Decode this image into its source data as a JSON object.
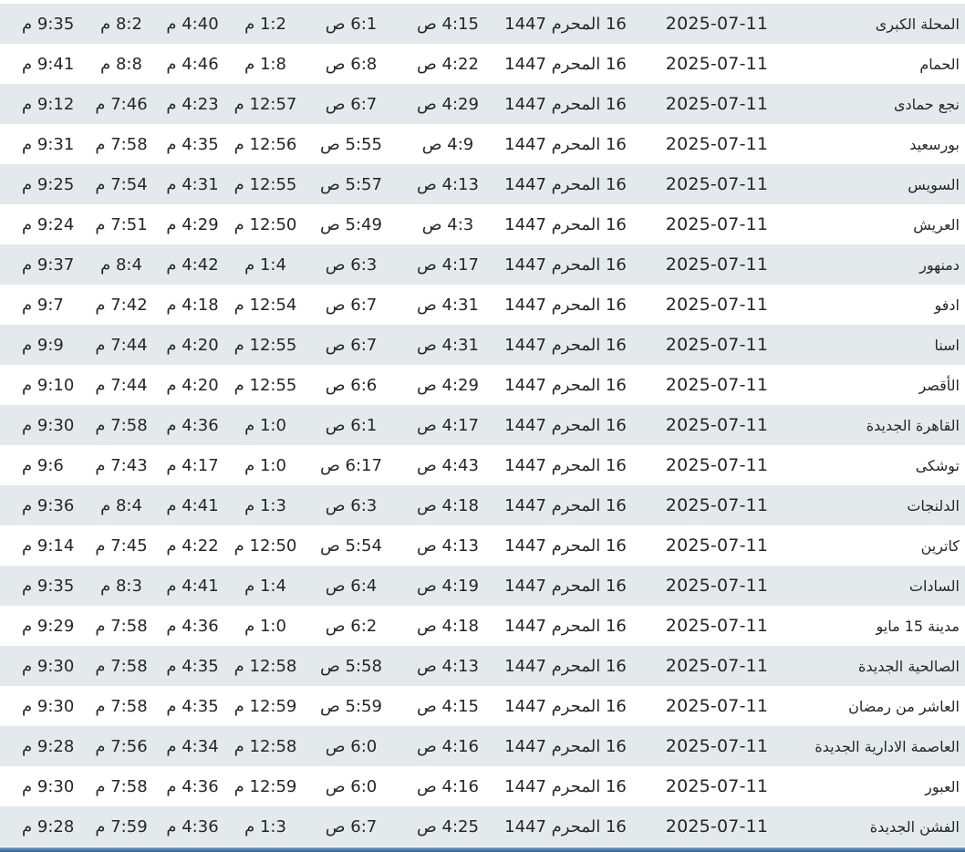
{
  "rows": [
    {
      "city": "المحلة الكبرى",
      "date": "2025-07-11",
      "hijri": "16 المحرم 1447",
      "fajr": "4:15 ص",
      "sunrise": "6:1 ص",
      "dhuhr": "1:2 م",
      "asr": "4:40 م",
      "maghrib": "8:2 م",
      "isha": "9:35 م"
    },
    {
      "city": "الحمام",
      "date": "2025-07-11",
      "hijri": "16 المحرم 1447",
      "fajr": "4:22 ص",
      "sunrise": "6:8 ص",
      "dhuhr": "1:8 م",
      "asr": "4:46 م",
      "maghrib": "8:8 م",
      "isha": "9:41 م"
    },
    {
      "city": "نجع حمادى",
      "date": "2025-07-11",
      "hijri": "16 المحرم 1447",
      "fajr": "4:29 ص",
      "sunrise": "6:7 ص",
      "dhuhr": "12:57 م",
      "asr": "4:23 م",
      "maghrib": "7:46 م",
      "isha": "9:12 م"
    },
    {
      "city": "بورسعيد",
      "date": "2025-07-11",
      "hijri": "16 المحرم 1447",
      "fajr": "4:9 ص",
      "sunrise": "5:55 ص",
      "dhuhr": "12:56 م",
      "asr": "4:35 م",
      "maghrib": "7:58 م",
      "isha": "9:31 م"
    },
    {
      "city": "السويس",
      "date": "2025-07-11",
      "hijri": "16 المحرم 1447",
      "fajr": "4:13 ص",
      "sunrise": "5:57 ص",
      "dhuhr": "12:55 م",
      "asr": "4:31 م",
      "maghrib": "7:54 م",
      "isha": "9:25 م"
    },
    {
      "city": "العريش",
      "date": "2025-07-11",
      "hijri": "16 المحرم 1447",
      "fajr": "4:3 ص",
      "sunrise": "5:49 ص",
      "dhuhr": "12:50 م",
      "asr": "4:29 م",
      "maghrib": "7:51 م",
      "isha": "9:24 م"
    },
    {
      "city": "دمنهور",
      "date": "2025-07-11",
      "hijri": "16 المحرم 1447",
      "fajr": "4:17 ص",
      "sunrise": "6:3 ص",
      "dhuhr": "1:4 م",
      "asr": "4:42 م",
      "maghrib": "8:4 م",
      "isha": "9:37 م"
    },
    {
      "city": "ادفو",
      "date": "2025-07-11",
      "hijri": "16 المحرم 1447",
      "fajr": "4:31 ص",
      "sunrise": "6:7 ص",
      "dhuhr": "12:54 م",
      "asr": "4:18 م",
      "maghrib": "7:42 م",
      "isha": "9:7 م"
    },
    {
      "city": "اسنا",
      "date": "2025-07-11",
      "hijri": "16 المحرم 1447",
      "fajr": "4:31 ص",
      "sunrise": "6:7 ص",
      "dhuhr": "12:55 م",
      "asr": "4:20 م",
      "maghrib": "7:44 م",
      "isha": "9:9 م"
    },
    {
      "city": "الأقصر",
      "date": "2025-07-11",
      "hijri": "16 المحرم 1447",
      "fajr": "4:29 ص",
      "sunrise": "6:6 ص",
      "dhuhr": "12:55 م",
      "asr": "4:20 م",
      "maghrib": "7:44 م",
      "isha": "9:10 م"
    },
    {
      "city": "القاهرة الجديدة",
      "date": "2025-07-11",
      "hijri": "16 المحرم 1447",
      "fajr": "4:17 ص",
      "sunrise": "6:1 ص",
      "dhuhr": "1:0 م",
      "asr": "4:36 م",
      "maghrib": "7:58 م",
      "isha": "9:30 م"
    },
    {
      "city": "توشكى",
      "date": "2025-07-11",
      "hijri": "16 المحرم 1447",
      "fajr": "4:43 ص",
      "sunrise": "6:17 ص",
      "dhuhr": "1:0 م",
      "asr": "4:17 م",
      "maghrib": "7:43 م",
      "isha": "9:6 م"
    },
    {
      "city": "الدلنجات",
      "date": "2025-07-11",
      "hijri": "16 المحرم 1447",
      "fajr": "4:18 ص",
      "sunrise": "6:3 ص",
      "dhuhr": "1:3 م",
      "asr": "4:41 م",
      "maghrib": "8:4 م",
      "isha": "9:36 م"
    },
    {
      "city": "كاترين",
      "date": "2025-07-11",
      "hijri": "16 المحرم 1447",
      "fajr": "4:13 ص",
      "sunrise": "5:54 ص",
      "dhuhr": "12:50 م",
      "asr": "4:22 م",
      "maghrib": "7:45 م",
      "isha": "9:14 م"
    },
    {
      "city": "السادات",
      "date": "2025-07-11",
      "hijri": "16 المحرم 1447",
      "fajr": "4:19 ص",
      "sunrise": "6:4 ص",
      "dhuhr": "1:4 م",
      "asr": "4:41 م",
      "maghrib": "8:3 م",
      "isha": "9:35 م"
    },
    {
      "city": "مدينة 15 مايو",
      "date": "2025-07-11",
      "hijri": "16 المحرم 1447",
      "fajr": "4:18 ص",
      "sunrise": "6:2 ص",
      "dhuhr": "1:0 م",
      "asr": "4:36 م",
      "maghrib": "7:58 م",
      "isha": "9:29 م"
    },
    {
      "city": "الصالحية الجديدة",
      "date": "2025-07-11",
      "hijri": "16 المحرم 1447",
      "fajr": "4:13 ص",
      "sunrise": "5:58 ص",
      "dhuhr": "12:58 م",
      "asr": "4:35 م",
      "maghrib": "7:58 م",
      "isha": "9:30 م"
    },
    {
      "city": "العاشر من رمضان",
      "date": "2025-07-11",
      "hijri": "16 المحرم 1447",
      "fajr": "4:15 ص",
      "sunrise": "5:59 ص",
      "dhuhr": "12:59 م",
      "asr": "4:35 م",
      "maghrib": "7:58 م",
      "isha": "9:30 م"
    },
    {
      "city": "العاصمة الادارية الجديدة",
      "date": "2025-07-11",
      "hijri": "16 المحرم 1447",
      "fajr": "4:16 ص",
      "sunrise": "6:0 ص",
      "dhuhr": "12:58 م",
      "asr": "4:34 م",
      "maghrib": "7:56 م",
      "isha": "9:28 م"
    },
    {
      "city": "العبور",
      "date": "2025-07-11",
      "hijri": "16 المحرم 1447",
      "fajr": "4:16 ص",
      "sunrise": "6:0 ص",
      "dhuhr": "12:59 م",
      "asr": "4:36 م",
      "maghrib": "7:58 م",
      "isha": "9:30 م"
    },
    {
      "city": "الفشن الجديدة",
      "date": "2025-07-11",
      "hijri": "16 المحرم 1447",
      "fajr": "4:25 ص",
      "sunrise": "6:7 ص",
      "dhuhr": "1:3 م",
      "asr": "4:36 م",
      "maghrib": "7:59 م",
      "isha": "9:28 م"
    }
  ],
  "colors": {
    "shaded_row": "#e4e9ec",
    "plain_row": "#ffffff",
    "text": "#262626",
    "bottom_bar": "#2d5f94"
  }
}
